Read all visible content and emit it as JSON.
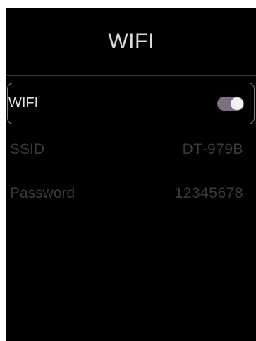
{
  "header": {
    "title": "WIFI"
  },
  "settings": {
    "wifi": {
      "label": "WIFI",
      "enabled": true,
      "toggle_color": "#7d6e86"
    },
    "ssid": {
      "label": "SSID",
      "value": "DT-979B"
    },
    "password": {
      "label": "Password",
      "value": "12345678"
    }
  },
  "colors": {
    "background": "#000000",
    "text_active": "#e2e2e2",
    "text_dimmed": "#3c3c3c"
  }
}
